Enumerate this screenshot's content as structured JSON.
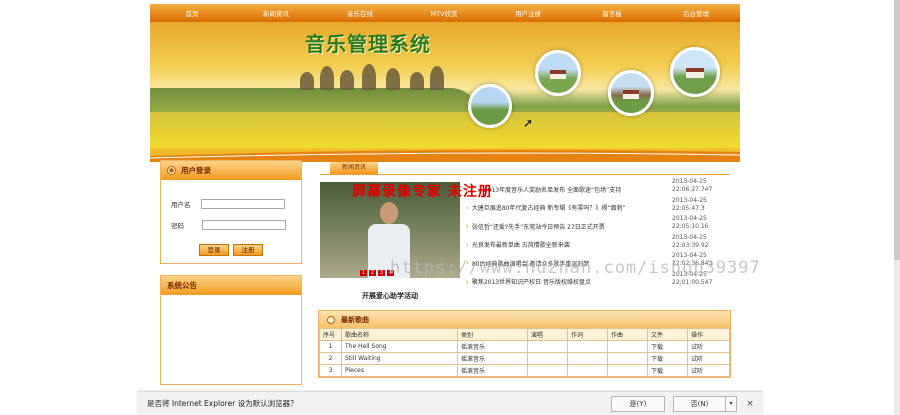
{
  "nav": {
    "items": [
      "首页",
      "新闻资讯",
      "音乐在线",
      "MTV欣赏",
      "用户注册",
      "留言板",
      "后台管理"
    ]
  },
  "banner": {
    "title": "音乐管理系统"
  },
  "login": {
    "header": "用户登录",
    "username_label": "用户名",
    "password_label": "密码",
    "login_button": "登录",
    "register_button": "注册"
  },
  "notice": {
    "header": "系统公告"
  },
  "news": {
    "tab_label": "新闻资讯",
    "photo_caption": "开展爱心助学活动",
    "photo_dots": [
      "1",
      "2",
      "3",
      "4"
    ],
    "items": [
      "……2013年度音乐人奖励名单发布 全面歌迷“包场”支持",
      "大唐巨展追80年代复古经典 新专辑《有零吗？》揭“面刺”",
      "张信哲“还爱?先手”东莞站今日预告 27日正式开票",
      "光良发布最新单曲 古风情歌全新来袭",
      "80后经典歌曲演唱会 邀请众多歌手重温旧梦",
      "聚焦2013世界知识产权日 音乐版权维权盘点"
    ],
    "times": [
      "2013-04-25 22:06:27.747",
      "2013-04-25 22:05:47.3",
      "2013-04-25 22:05:10.16",
      "2013-04-25 22:03:39.92",
      "2013-04-25 22:02:36.843",
      "2013-04-25 22:01:00.547"
    ]
  },
  "overlays": {
    "watermark_red": "屏幕录像专家 未注册",
    "watermark_url": "https://www.huzhan.com/ishop39397"
  },
  "songs": {
    "header": "最新歌曲",
    "columns": [
      "序号",
      "歌曲名称",
      "类别",
      "演唱",
      "作词",
      "作曲",
      "文件",
      "操作"
    ],
    "rows": [
      [
        "1",
        "The Hell Song",
        "摇滚音乐",
        "",
        "",
        "",
        "下载",
        "试听"
      ],
      [
        "2",
        "Still Waiting",
        "摇滚音乐",
        "",
        "",
        "",
        "下载",
        "试听"
      ],
      [
        "3",
        "Pieces",
        "摇滚音乐",
        "",
        "",
        "",
        "下载",
        "试听"
      ]
    ]
  },
  "iebar": {
    "message": "是否将 Internet Explorer 设为默认浏览器？",
    "yes_button": "是(Y)",
    "no_button": "否(N)",
    "dropdown_glyph": "▾",
    "close_glyph": "×"
  },
  "colors": {
    "accent": "#f39a1e",
    "nav_dark": "#d96a00",
    "title_green": "#2e7a1e",
    "watermark_red": "#e00000"
  }
}
